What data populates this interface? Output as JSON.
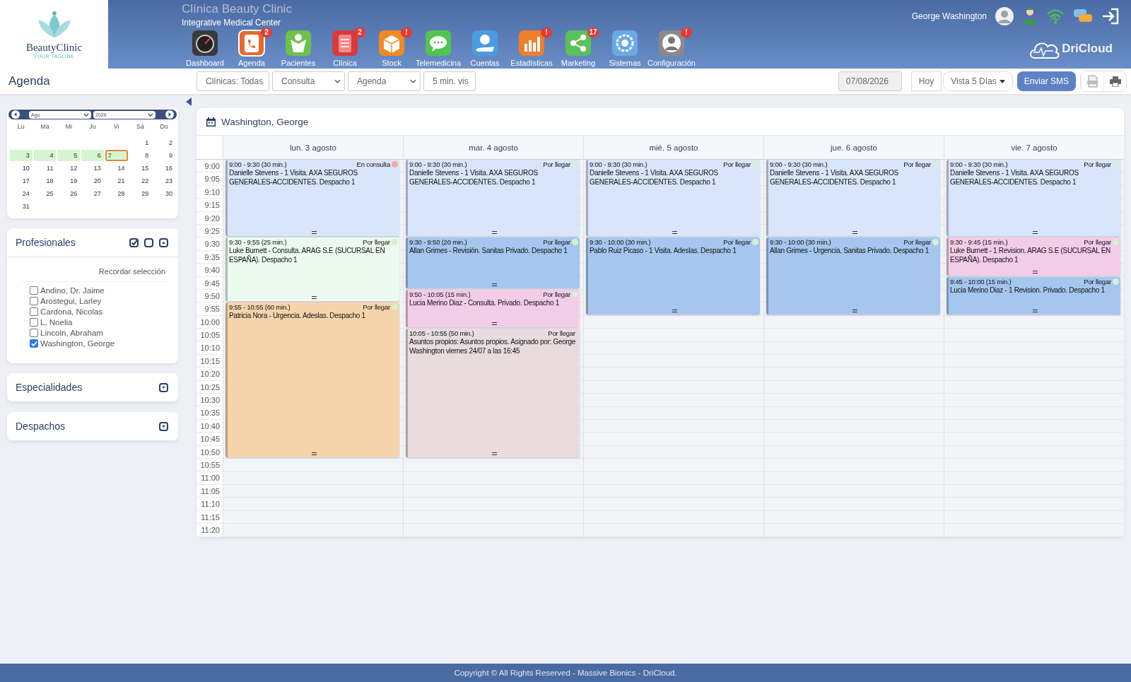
{
  "logo": {
    "name": "BeautyClinic",
    "tagline": "YOUR TAGLINE"
  },
  "header": {
    "title": "Clínica Beauty Clinic",
    "subtitle": "Integrative Medical Center",
    "user": "George Washington",
    "brand": "DriCloud"
  },
  "nav": [
    {
      "label": "Dashboard",
      "selected": false
    },
    {
      "label": "Agenda",
      "badge": "2",
      "selected": true
    },
    {
      "label": "Pacientes",
      "selected": false
    },
    {
      "label": "Clínica",
      "badge": "2",
      "selected": false
    },
    {
      "label": "Stock",
      "badge": "!",
      "selected": false
    },
    {
      "label": "Telemedicina",
      "selected": false
    },
    {
      "label": "Cuentas",
      "selected": false
    },
    {
      "label": "Estadísticas",
      "badge": "!",
      "selected": false
    },
    {
      "label": "Marketing",
      "badge": "17",
      "selected": false
    },
    {
      "label": "Sistemas",
      "selected": false
    },
    {
      "label": "Configuración",
      "badge": "!",
      "selected": false
    }
  ],
  "toolbar": {
    "title": "Agenda",
    "selects": [
      "Clínicas: Todas",
      "Consulta",
      "Agenda",
      "5 min. vis"
    ],
    "date": "07/08/2026",
    "today": "Hoy",
    "view": "Vista 5 Días",
    "sms": "Enviar SMS"
  },
  "mini_calendar": {
    "month": "Ago",
    "year": "2026",
    "weekdays": [
      "Lu",
      "Ma",
      "Mi",
      "Ju",
      "Vi",
      "Sá",
      "Do"
    ],
    "weeks": [
      [
        {
          "day": "1",
          "in_range": false,
          "selected": false
        },
        {
          "day": "2",
          "in_range": false,
          "selected": false
        }
      ],
      [
        {
          "day": "3",
          "in_range": true,
          "selected": false
        },
        {
          "day": "4",
          "in_range": true,
          "selected": false
        },
        {
          "day": "5",
          "in_range": true,
          "selected": false
        },
        {
          "day": "6",
          "in_range": true,
          "selected": false
        },
        {
          "day": "7",
          "in_range": true,
          "selected": true
        },
        {
          "day": "8",
          "in_range": false,
          "selected": false
        },
        {
          "day": "9",
          "in_range": false,
          "selected": false
        }
      ],
      [
        {
          "day": "10",
          "in_range": false,
          "selected": false
        },
        {
          "day": "11",
          "in_range": false,
          "selected": false
        },
        {
          "day": "12",
          "in_range": false,
          "selected": false
        },
        {
          "day": "13",
          "in_range": false,
          "selected": false
        },
        {
          "day": "14",
          "in_range": false,
          "selected": false
        },
        {
          "day": "15",
          "in_range": false,
          "selected": false
        },
        {
          "day": "16",
          "in_range": false,
          "selected": false
        }
      ],
      [
        {
          "day": "17",
          "in_range": false,
          "selected": false
        },
        {
          "day": "18",
          "in_range": false,
          "selected": false
        },
        {
          "day": "19",
          "in_range": false,
          "selected": false
        },
        {
          "day": "20",
          "in_range": false,
          "selected": false
        },
        {
          "day": "21",
          "in_range": false,
          "selected": false
        },
        {
          "day": "22",
          "in_range": false,
          "selected": false
        },
        {
          "day": "23",
          "in_range": false,
          "selected": false
        }
      ],
      [
        {
          "day": "24",
          "in_range": false,
          "selected": false
        },
        {
          "day": "25",
          "in_range": false,
          "selected": false
        },
        {
          "day": "26",
          "in_range": false,
          "selected": false
        },
        {
          "day": "27",
          "in_range": false,
          "selected": false
        },
        {
          "day": "28",
          "in_range": false,
          "selected": false
        },
        {
          "day": "29",
          "in_range": false,
          "selected": false
        },
        {
          "day": "30",
          "in_range": false,
          "selected": false
        }
      ],
      [
        {
          "day": "31",
          "in_range": false,
          "selected": false
        }
      ]
    ]
  },
  "panels": [
    {
      "title": "Profesionales",
      "expanded": true,
      "remember": "Recordar selección",
      "items": [
        {
          "label": "Andino, Dr. Jaime",
          "checked": false
        },
        {
          "label": "Arostegui, Larley",
          "checked": false
        },
        {
          "label": "Cardona, Nicolas",
          "checked": false
        },
        {
          "label": "L, Noelia",
          "checked": false
        },
        {
          "label": "Lincoln, Abraham",
          "checked": false
        },
        {
          "label": "Washington, George",
          "checked": true
        }
      ]
    },
    {
      "title": "Especialidades",
      "expanded": false
    },
    {
      "title": "Despachos",
      "expanded": false
    }
  ],
  "schedule": {
    "title": "Washington, George",
    "times": [
      "9:00",
      "9:05",
      "9:10",
      "9:15",
      "9:20",
      "9:25",
      "9:30",
      "9:35",
      "9:40",
      "9:45",
      "9:50",
      "9:55",
      "10:00",
      "10:05",
      "10:10",
      "10:15",
      "10:20",
      "10:25",
      "10:30",
      "10:35",
      "10:40",
      "10:45",
      "10:50",
      "10:55",
      "11:00",
      "11:05",
      "11:10",
      "11:15",
      "11:20"
    ],
    "days": [
      {
        "label": "lun. 3 agosto",
        "events": [
          {
            "time": "9:00 - 9:30 (30 min.)",
            "status": {
              "label": "En consulta",
              "color": "#f2a9a9"
            },
            "text": "Danielle Stevens - 1 Visita. AXA SEGUROS GENERALES-ACCIDENTES. Despacho 1",
            "color": "#d9e5fb"
          },
          {
            "time": "9:30 - 9:55 (25 min.)",
            "status": {
              "label": "Por llegar",
              "color": "#d3f2d3"
            },
            "text": "Luke Burnett - Consulta. ARAG S.E (SUCURSAL EN ESPAÑA). Despacho 1",
            "color": "#ebfbee"
          },
          {
            "time": "9:55 - 10:55 (60 min.)",
            "status": {
              "label": "Por llegar",
              "color": "#d3f2d3"
            },
            "text": "Patricia Nora - Urgencia. Adeslas. Despacho 1",
            "color": "#f6d4ab"
          }
        ]
      },
      {
        "label": "mar. 4 agosto",
        "events": [
          {
            "time": "9:00 - 9:30 (30 min.)",
            "status": {
              "label": "Por llegar",
              "color": "#d3f2d3"
            },
            "text": "Danielle Stevens - 1 Visita. AXA SEGUROS GENERALES-ACCIDENTES. Despacho 1",
            "color": "#d9e5fb"
          },
          {
            "time": "9:30 - 9:50 (20 min.)",
            "status": {
              "label": "Por llegar",
              "color": "#d3f2d3"
            },
            "text": "Allan Grimes - Revisión. Sanitas Privado. Despacho 1",
            "color": "#a5c6ee"
          },
          {
            "time": "9:50 - 10:05 (15 min.)",
            "status": {
              "label": "Por llegar",
              "color": "#d3f2d3"
            },
            "text": "Lucia Merino Diaz - Consulta. Privado. Despacho 1",
            "color": "#f3cce8"
          },
          {
            "time": "10:05 - 10:55 (50 min.)",
            "status": {
              "label": "Por llegar"
            },
            "text": "Asuntos propios: Asuntos propios. Asignado por: George Washington viernes 24/07 a las 16:45",
            "color": "#e8dcdf"
          }
        ]
      },
      {
        "label": "mié. 5 agosto",
        "events": [
          {
            "time": "9:00 - 9:30 (30 min.)",
            "status": {
              "label": "Por llegar",
              "color": "#d3f2d3"
            },
            "text": "Danielle Stevens - 1 Visita. AXA SEGUROS GENERALES-ACCIDENTES. Despacho 1",
            "color": "#d9e5fb"
          },
          {
            "time": "9:30 - 10:00 (30 min.)",
            "status": {
              "label": "Por llegar",
              "color": "#d3f2d3"
            },
            "text": "Pablo Ruiz Picaso - 1 Visita. Adeslas. Despacho 1",
            "color": "#a5c6ee"
          }
        ]
      },
      {
        "label": "jue. 6 agosto",
        "events": [
          {
            "time": "9:00 - 9:30 (30 min.)",
            "status": {
              "label": "Por llegar",
              "color": "#d3f2d3"
            },
            "text": "Danielle Stevens - 1 Visita. AXA SEGUROS GENERALES-ACCIDENTES. Despacho 1",
            "color": "#d9e5fb"
          },
          {
            "time": "9:30 - 10:00 (30 min.)",
            "status": {
              "label": "Por llegar",
              "color": "#d3f2d3"
            },
            "text": "Allan Grimes - Urgencia. Sanitas Privado. Despacho 1",
            "color": "#a5c6ee"
          }
        ]
      },
      {
        "label": "vie. 7 agosto",
        "events": [
          {
            "time": "9:00 - 9:30 (30 min.)",
            "status": {
              "label": "Por llegar",
              "color": "#d3f2d3"
            },
            "text": "Danielle Stevens - 1 Visita. AXA SEGUROS GENERALES-ACCIDENTES. Despacho 1",
            "color": "#d9e5fb"
          },
          {
            "time": "9:30 - 9:45 (15 min.)",
            "status": {
              "label": "Por llegar",
              "color": "#d3f2d3"
            },
            "text": "Luke Burnett - 1 Revision. ARAG S.E (SUCURSAL EN ESPAÑA). Despacho 1",
            "color": "#f3cce8"
          },
          {
            "time": "9:45 - 10:00 (15 min.)",
            "status": {
              "label": "Por llegar",
              "color": "#d3f2d3"
            },
            "text": "Lucia Merino Diaz - 1 Revision. Privado. Despacho 1",
            "color": "#a5c6ee"
          }
        ]
      }
    ]
  },
  "footer": "Copyright © All Rights Reserved - Massive Bionics - DriCloud."
}
